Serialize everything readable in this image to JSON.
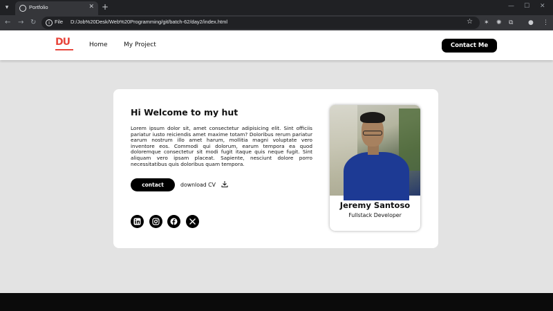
{
  "browser": {
    "tab_title": "Portfolio",
    "address_scheme": "File",
    "url": "D:/Job%20Desk/Web%20Programming/git/batch-62/day2/index.html"
  },
  "nav": {
    "logo_text": "DU",
    "links": [
      "Home",
      "My Project"
    ],
    "cta": "Contact Me"
  },
  "hero": {
    "heading": "Hi Welcome to my hut",
    "paragraph": "Lorem ipsum dolor sit, amet consectetur adipisicing elit. Sint officiis pariatur iusto reiciendis amet maxime totam? Doloribus rerum pariatur earum nostrum illo amet harum, mollitia magni voluptate vero inventore eos. Commodi qui dolorum, earum tempora ea quod doloremque consectetur sit modi fugit itaque quis neque fugit. Sint aliquam vero ipsam placeat. Sapiente, nesciunt dolore porro necessitatibus quis doloribus quam tempora.",
    "contact_button": "contact",
    "download_label": "download CV"
  },
  "social": {
    "icons": [
      "linkedin-icon",
      "instagram-icon",
      "facebook-icon",
      "x-icon"
    ]
  },
  "profile": {
    "name": "Jeremy Santoso",
    "role": "Fullstack Developer"
  }
}
